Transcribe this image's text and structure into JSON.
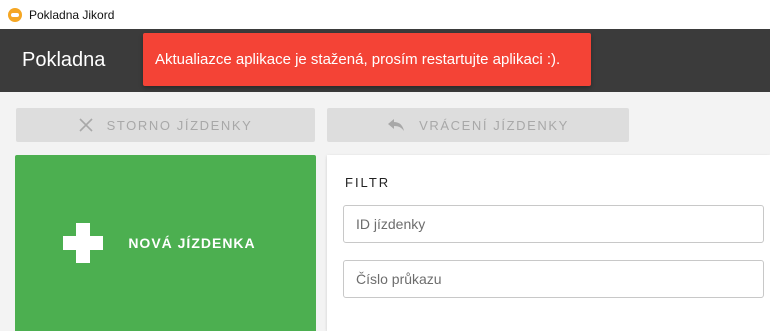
{
  "window": {
    "title": "Pokladna Jikord",
    "icon": "app-cloud-icon"
  },
  "appbar": {
    "title": "Pokladna"
  },
  "notification": {
    "text": "Aktualiazce aplikace je stažená, prosím restartujte aplikaci :).",
    "color": "#f44336"
  },
  "actions": {
    "storno": {
      "label": "STORNO JÍZDENKY",
      "icon": "close-icon",
      "disabled": true
    },
    "vraceni": {
      "label": "VRÁCENÍ JÍZDENKY",
      "icon": "reply-icon",
      "disabled": true
    }
  },
  "new_ticket": {
    "label": "NOVÁ JÍZDENKA",
    "icon": "plus-icon",
    "color": "#4caf50"
  },
  "filter": {
    "title": "FILTR",
    "ticket_id": {
      "placeholder": "ID jízdenky",
      "value": ""
    },
    "card_number": {
      "placeholder": "Číslo průkazu",
      "value": ""
    }
  }
}
